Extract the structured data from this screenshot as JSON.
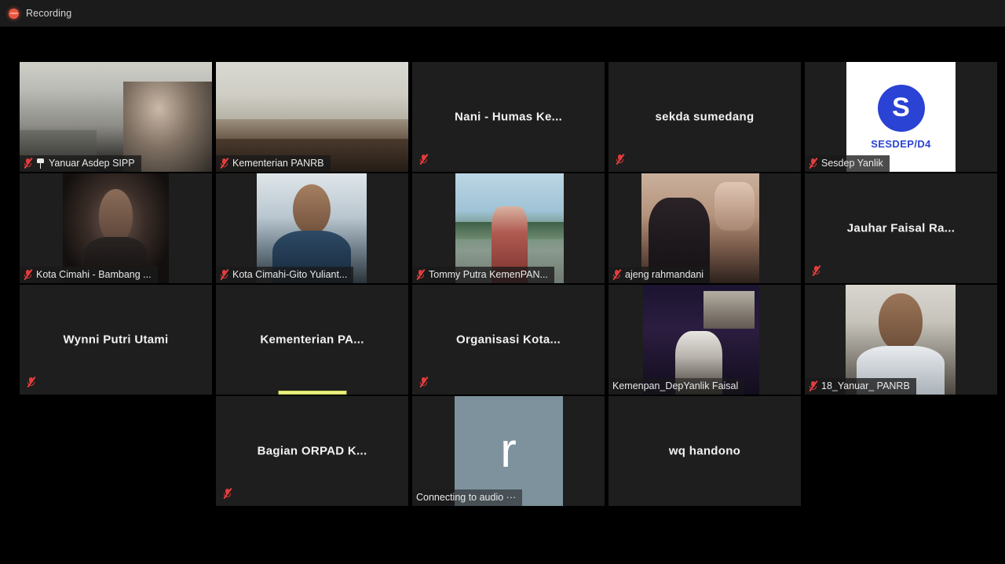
{
  "topbar": {
    "recording_label": "Recording",
    "recording_dot_color": "#e8563f"
  },
  "theme": {
    "background": "#000000",
    "tile_background": "#1e1e1e",
    "active_speaker_border": "#d9e85c",
    "mute_icon_color": "#e03b3b",
    "avatar_blue": "#2a43d4",
    "avatar_gray": "#7d929d"
  },
  "gallery": {
    "columns": 5,
    "rows": 4,
    "participants": [
      {
        "name": "Yanuar Asdep SIPP",
        "label_style": "namebar",
        "video": true,
        "muted": true,
        "pinned": true,
        "active_speaker": true,
        "speaking": false
      },
      {
        "name": "Kementerian PANRB",
        "label_style": "namebar",
        "video": true,
        "muted": true,
        "pinned": false,
        "active_speaker": false,
        "speaking": false
      },
      {
        "name": "Nani - Humas Ke...",
        "label_style": "center",
        "video": false,
        "muted": true,
        "pinned": false,
        "active_speaker": false,
        "speaking": false
      },
      {
        "name": "sekda sumedang",
        "label_style": "center",
        "video": false,
        "muted": true,
        "pinned": false,
        "active_speaker": false,
        "speaking": false
      },
      {
        "name": "Sesdep Yanlik",
        "label_style": "namebar",
        "video": false,
        "avatar_type": "circle-letter",
        "avatar_letter": "S",
        "avatar_caption": "SESDEP/D4",
        "muted": true,
        "pinned": false,
        "active_speaker": false,
        "speaking": false
      },
      {
        "name": "Kota Cimahi - Bambang ...",
        "label_style": "namebar",
        "video": true,
        "muted": true,
        "pinned": false,
        "active_speaker": false,
        "speaking": false
      },
      {
        "name": "Kota Cimahi-Gito Yuliant...",
        "label_style": "namebar",
        "video": true,
        "muted": true,
        "pinned": false,
        "active_speaker": false,
        "speaking": false
      },
      {
        "name": "Tommy Putra KemenPAN...",
        "label_style": "namebar",
        "video": true,
        "muted": true,
        "pinned": false,
        "active_speaker": false,
        "speaking": false
      },
      {
        "name": "ajeng rahmandani",
        "label_style": "namebar",
        "video": true,
        "muted": true,
        "pinned": false,
        "active_speaker": false,
        "speaking": false
      },
      {
        "name": "Jauhar Faisal Ra...",
        "label_style": "center",
        "video": false,
        "muted": true,
        "pinned": false,
        "active_speaker": false,
        "speaking": false
      },
      {
        "name": "Wynni Putri Utami",
        "label_style": "center",
        "video": false,
        "muted": true,
        "pinned": false,
        "active_speaker": false,
        "speaking": false
      },
      {
        "name": "Kementerian PA...",
        "label_style": "center",
        "video": false,
        "muted": false,
        "pinned": false,
        "active_speaker": false,
        "speaking": true
      },
      {
        "name": "Organisasi Kota...",
        "label_style": "center",
        "video": false,
        "muted": true,
        "pinned": false,
        "active_speaker": false,
        "speaking": false
      },
      {
        "name": "Kemenpan_DepYanlik Faisal",
        "label_style": "namebar-plain",
        "video": true,
        "muted": false,
        "pinned": false,
        "active_speaker": false,
        "speaking": false
      },
      {
        "name": "18_Yanuar_ PANRB",
        "label_style": "namebar",
        "video": true,
        "muted": true,
        "pinned": false,
        "active_speaker": false,
        "speaking": false
      },
      {
        "name": "Bagian ORPAD K...",
        "label_style": "center",
        "video": false,
        "muted": true,
        "pinned": false,
        "active_speaker": false,
        "speaking": false
      },
      {
        "name": "Connecting to audio ···",
        "label_style": "namebar-plain",
        "video": false,
        "avatar_type": "square-letter",
        "avatar_letter": "r",
        "muted": false,
        "pinned": false,
        "active_speaker": false,
        "speaking": false
      },
      {
        "name": "wq handono",
        "label_style": "center",
        "video": false,
        "muted": false,
        "pinned": false,
        "active_speaker": false,
        "speaking": false
      }
    ]
  }
}
